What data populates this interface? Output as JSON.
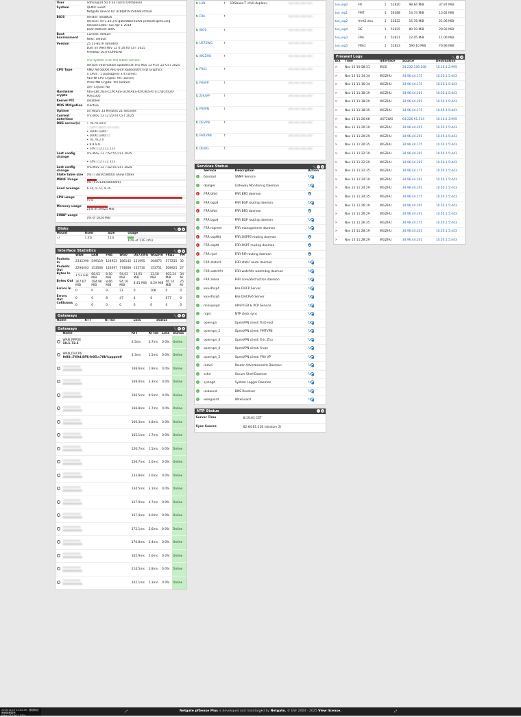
{
  "sysinfo": [
    {
      "k": "User",
      "v": [
        "admin@10.50.0.33 (Local Database)"
      ]
    },
    {
      "k": "System",
      "v": [
        "QEMU Guest",
        "Netgate Device ID: 4c6b8fc915d0843fc0ad"
      ]
    },
    {
      "k": "BIOS",
      "v": [
        "Vendor: SeaBIOS",
        "Version: rel-1.16.3-0-ga6ed6b701f0a-prebuilt.qemu.org",
        "Release Date: Tue Apr 1 2014",
        "Boot Method: BIOS"
      ]
    },
    {
      "k": "Boot Environment",
      "v": [
        "Current: default",
        "Next: default"
      ]
    },
    {
      "k": "Version",
      "v": [
        "25.11-BETA (amd64)",
        "built on Wed Nov 12 4:16:00 CST 2025",
        "FreeBSD 16.0-CURRENT",
        "",
        "The system is on the latest version.",
        "Version information updated at Thu Nov 13 9:57:22 CST 2025"
      ]
    },
    {
      "k": "CPU Type",
      "v": [
        "AMD A8-5600K APU with Radeon(tm) HD Graphics",
        "4 CPUs : 1 package(s) x 4 core(s)",
        "AES-NI CPU Crypto: Yes (active)",
        "IPsec-MB Crypto: Yes (active)",
        "QAT Crypto: No"
      ]
    },
    {
      "k": "Hardware crypto",
      "v": [
        "AES-CBC,AES-CCM,AES-GCM,AES-ICM,AES-XTS,ChaCha20-",
        "Poly1305"
      ]
    },
    {
      "k": "Kernel PTI",
      "v": [
        "Disabled"
      ]
    },
    {
      "k": "MDS Mitigation",
      "v": [
        "Inactive"
      ]
    },
    {
      "k": "Uptime",
      "v": [
        "04 Hours 33 Minutes 21 Seconds"
      ]
    },
    {
      "k": "Current date/time",
      "v": [
        "Thu Nov 13 12:20:47 CST 2025"
      ]
    },
    {
      "k": "DNS server(s)",
      "v": [
        "• 76.76.10.0",
        "• 2a07:a8c0::xx:xxxx",
        "• 2606:1a40::",
        "• 2606:1a40:1::",
        "• 76.76.2.0",
        "• 9.9.9.9",
        "• 149.112.112.112"
      ]
    },
    {
      "k": "Last config change",
      "v": [
        "Thu Nov 13 7:52:55 CST 2025",
        "",
        "• 149.112.112.112"
      ]
    },
    {
      "k": "Last config change",
      "v": [
        "Thu Nov 13 7:52:55 CST 2025"
      ]
    },
    {
      "k": "State table size",
      "v": [
        "0% (738/3058000) Show states"
      ]
    }
  ],
  "gauges": [
    {
      "k": "MBUF Usage",
      "v": "9% (470134/5000000)",
      "pct": 9,
      "top": true
    },
    {
      "k": "Load average",
      "v": "6.14, 5.72, 4.35",
      "pct": -1
    },
    {
      "k": "CPU usage",
      "v": "97%",
      "pct": 97
    },
    {
      "k": "Memory usage",
      "v": "21% of 20425 MiB",
      "pct": 21
    },
    {
      "k": "SWAP usage",
      "v": "0% of 1024 MiB",
      "pct": 0
    }
  ],
  "disks": {
    "title": "Disks",
    "headers": [
      "Mount",
      "Used",
      "Size",
      "Usage"
    ],
    "row": [
      "/",
      "1.2G",
      "11G",
      "10% of 11G (zfs)"
    ],
    "pct": 10
  },
  "ifstats": {
    "title": "Interface Statistics",
    "headers": [
      "",
      "WAN",
      "LAN",
      "FRA",
      "WG0",
      "US72WG",
      "WGZHU",
      "FRA1",
      "FM"
    ],
    "rows": [
      [
        "Packets In",
        "2332390",
        "549119",
        "124923",
        "186145",
        "151995",
        "164075",
        "577255",
        "32"
      ],
      [
        "Packets Out",
        "2294403",
        "353568",
        "128397",
        "774668",
        "155710",
        "153751",
        "568925",
        "27"
      ],
      [
        "Bytes In",
        "1.53 GiB",
        "68.63 MiB",
        "8.50 MiB",
        "94.62 MiB",
        "10.91 MiB",
        "11.58 MiB",
        "605.24 MiB",
        "34 Mi"
      ],
      [
        "Bytes Out",
        "367.67 MiB",
        "184.96 MiB",
        "8.66 MiB",
        "94.16 MiB",
        "8.41 MiB",
        "8.29 MiB",
        "46.14 MiB",
        "25 Mi"
      ],
      [
        "Errors In",
        "0",
        "0",
        "9",
        "21",
        "0",
        "108",
        "0",
        "0"
      ],
      [
        "Errors Out",
        "0",
        "0",
        "8",
        "47",
        "4",
        "6",
        "677",
        "0"
      ],
      [
        "Collisions",
        "0",
        "0",
        "0",
        "0",
        "0",
        "0",
        "0",
        "0"
      ]
    ]
  },
  "gateways_a": {
    "title": "Gateways",
    "headers": [
      "Name",
      "RTT",
      "RTTsd",
      "Loss",
      "Status"
    ]
  },
  "gateways_b": {
    "title": "Gateways",
    "headers": [
      "Name",
      "RTT",
      "RTTsd",
      "Loss",
      "Status"
    ],
    "rows": [
      [
        "WAN_PPPOE",
        "10.1.72.1",
        "2.5ms",
        "0.7ms",
        "0.0%",
        "Online",
        false
      ],
      [
        "WAN_DHCP6",
        "fe80::769d:8fff:fe05:c78b%pppoe0",
        "4.3ms",
        "2.5ms",
        "0.0%",
        "Online",
        false
      ],
      [
        "xxx",
        "xxx",
        "168.6ms",
        "1.9ms",
        "0.0%",
        "Online",
        true
      ],
      [
        "xxx",
        "xxx",
        "169.0ms",
        "3.3ms",
        "0.0%",
        "Online",
        true
      ],
      [
        "xxx",
        "xxx",
        "166.5ms",
        "9.5ms",
        "0.0%",
        "Online",
        true
      ],
      [
        "xxx",
        "xxx",
        "168.8ms",
        "2.7ms",
        "0.0%",
        "Online",
        true
      ],
      [
        "xxx",
        "xxx",
        "166.3ms",
        "0.8ms",
        "0.0%",
        "Online",
        true
      ],
      [
        "xxx",
        "xxx",
        "165.1ms",
        "1.7ms",
        "0.0%",
        "Online",
        true
      ],
      [
        "xxx",
        "xxx",
        "156.7ms",
        "1.5ms",
        "0.0%",
        "Online",
        true
      ],
      [
        "xxx",
        "xxx",
        "156.7ms",
        "2.0ms",
        "0.0%",
        "Online",
        true
      ],
      [
        "xxx",
        "xxx",
        "233.8ms",
        "2.6ms",
        "0.0%",
        "Online",
        true
      ],
      [
        "xxx",
        "xxx",
        "234.5ms",
        "3.1ms",
        "0.0%",
        "Online",
        true
      ],
      [
        "xxx",
        "xxx",
        "167.0ms",
        "4.7ms",
        "0.0%",
        "Online",
        true
      ],
      [
        "xxx",
        "xxx",
        "167.4ms",
        "6.0ms",
        "0.0%",
        "Online",
        true
      ],
      [
        "xxx",
        "xxx",
        "172.1ms",
        "5.6ms",
        "0.0%",
        "Online",
        true
      ],
      [
        "xxx",
        "xxx",
        "170.8ms",
        "3.4ms",
        "0.0%",
        "Online",
        true
      ],
      [
        "xxx",
        "xxx",
        "165.9ms",
        "5.6ms",
        "0.0%",
        "Online",
        true
      ],
      [
        "xxx",
        "xxx",
        "214.5ms",
        "1.8ms",
        "0.0%",
        "Online",
        true
      ],
      [
        "xxx",
        "xxx",
        "202.1ms",
        "2.3ms",
        "0.0%",
        "Online",
        true
      ]
    ]
  },
  "interfaces": [
    {
      "n": "LAN",
      "v": "10Gbase-T <full-duplex>"
    },
    {
      "n": "FRA",
      "v": ""
    },
    {
      "n": "WG0",
      "v": ""
    },
    {
      "n": "US72WG",
      "v": ""
    },
    {
      "n": "WGZHU",
      "v": ""
    },
    {
      "n": "FRA1",
      "v": ""
    },
    {
      "n": "FRAVP",
      "v": ""
    },
    {
      "n": "ZHUVP",
      "v": ""
    },
    {
      "n": "FRVPN",
      "v": ""
    },
    {
      "n": "DEVPN",
      "v": ""
    },
    {
      "n": "FMTVPN",
      "v": ""
    },
    {
      "n": "DEWG",
      "v": ""
    }
  ],
  "services": {
    "title": "Services Status",
    "headers": [
      "",
      "Service",
      "Description",
      "Action"
    ],
    "rows": [
      [
        "ok",
        "bsnmpd",
        "SNMP Service",
        "r"
      ],
      [
        "ok",
        "dpinger",
        "Gateway Monitoring Daemon",
        "r"
      ],
      [
        "bad",
        "FRR bfdd",
        "FRR BFD daemon",
        "g"
      ],
      [
        "ok",
        "FRR bgpd",
        "FRR BGP routing daemon",
        "r"
      ],
      [
        "bad",
        "FRR bfdd",
        "FRR BFD daemon",
        "g"
      ],
      [
        "ok",
        "FRR bgpd",
        "FRR BGP routing daemon",
        "r"
      ],
      [
        "ok",
        "FRR mgmtd",
        "FRR management daemon",
        "r"
      ],
      [
        "bad",
        "FRR ospf6d",
        "FRR OSPF6 routing daemon",
        "g"
      ],
      [
        "bad",
        "FRR ospfd",
        "FRR OSPF routing daemon",
        "g"
      ],
      [
        "bad",
        "FRR ripd",
        "FRR RIP routing daemon",
        "g"
      ],
      [
        "ok",
        "FRR staticd",
        "FRR static route daemon",
        "r"
      ],
      [
        "ok",
        "FRR watchfrr",
        "FRR watchfrr watchdog daemon",
        "r"
      ],
      [
        "ok",
        "FRR zebra",
        "FRR core/abstraction daemon",
        "r"
      ],
      [
        "ok",
        "kea-dhcp4",
        "Kea DHCP Server",
        "r"
      ],
      [
        "ok",
        "kea-dhcp6",
        "Kea DHCPv6 Server",
        "r"
      ],
      [
        "ok",
        "miniupnpd",
        "UPnP IGD & PCP Service",
        "r"
      ],
      [
        "ok",
        "ntpd",
        "NTP clock sync",
        "r"
      ],
      [
        "ok",
        "openvpn",
        "OpenVPN client: first-root",
        "r"
      ],
      [
        "ok",
        "openvpn_2",
        "OpenVPN client: FMTVPN",
        "r"
      ],
      [
        "ok",
        "openvpn_3",
        "OpenVPN client: Eric Zhu",
        "r"
      ],
      [
        "ok",
        "openvpn_4",
        "OpenVPN client: frvpn",
        "r"
      ],
      [
        "ok",
        "openvpn_5",
        "OpenVPN client: FRA VP",
        "r"
      ],
      [
        "ok",
        "radvd",
        "Router Advertisement Daemon",
        "r"
      ],
      [
        "ok",
        "sshd",
        "Secure Shell Daemon",
        "r"
      ],
      [
        "ok",
        "syslogd",
        "System Logger Daemon",
        "r"
      ],
      [
        "ok",
        "unbound",
        "DNS Resolver",
        "r"
      ],
      [
        "ok",
        "wireguard",
        "WireGuard",
        "r"
      ]
    ]
  },
  "ntp": {
    "title": "NTP Status",
    "rows": [
      [
        "Server Time",
        "8:19:03 CST"
      ],
      [
        "Sync Source",
        "82.64.81.218 (stratum 2)"
      ]
    ]
  },
  "tunnels": [
    [
      "tun_wg0",
      "FR",
      "1",
      "51820",
      "98.84 MiB",
      "37.87 MiB"
    ],
    [
      "tun_wg1",
      "FMT",
      "1",
      "56388",
      "14.74 MiB",
      "13.62 MiB"
    ],
    [
      "tun_wg2",
      "frmt2 zhu",
      "1",
      "51822",
      "15.78 MiB",
      "21.06 MiB"
    ],
    [
      "tun_wg4",
      "DE",
      "1",
      "52825",
      "80.19 MiB",
      "20.92 MiB"
    ],
    [
      "tun_wg3",
      "FRA",
      "1",
      "51821",
      "12.05 MiB",
      "11.06 MiB"
    ],
    [
      "tun_wg5",
      "FRA1",
      "1",
      "51823",
      "590.10 MiB",
      "70.96 MiB"
    ]
  ],
  "firewall": {
    "title": "Firewall Logs",
    "headers": [
      "Act",
      "Time",
      "Interface",
      "Source",
      "Destination"
    ],
    "rows": [
      [
        "Nov 13 10:58:31",
        "WG0",
        "34.232.109.108",
        "10.16.1.2:995"
      ],
      [
        "Nov 13 11:14:34",
        "WGZHU",
        "34.96.44.175",
        "10.50.1.5:443"
      ],
      [
        "Nov 13 11:16:34",
        "WGZHU",
        "34.96.44.175",
        "10.50.1.5:443"
      ],
      [
        "Nov 13 11:18:19",
        "WGZHU",
        "34.96.44.201",
        "10.50.1.5:443"
      ],
      [
        "Nov 13 11:18:29",
        "WGZHU",
        "34.96.44.201",
        "10.50.1.5:443"
      ],
      [
        "Nov 13 11:18:35",
        "WGZHU",
        "34.96.44.175",
        "10.50.1.5:443"
      ],
      [
        "Nov 13 11:20:06",
        "US72WG",
        "64.226.91.114",
        "10.10.2.3:995"
      ],
      [
        "Nov 13 11:20:19",
        "WGZHU",
        "34.96.44.201",
        "10.50.1.5:443"
      ],
      [
        "Nov 13 11:20:29",
        "WGZHU",
        "34.96.44.201",
        "10.50.1.5:443"
      ],
      [
        "Nov 13 11:20:35",
        "WGZHU",
        "34.96.44.175",
        "10.50.1.5:443"
      ],
      [
        "Nov 13 11:22:19",
        "WGZHU",
        "34.96.44.201",
        "10.50.1.5:443"
      ],
      [
        "Nov 13 11:22:29",
        "WGZHU",
        "34.96.44.201",
        "10.50.1.5:443"
      ],
      [
        "Nov 13 11:22:35",
        "WGZHU",
        "34.96.44.175",
        "10.50.1.5:443"
      ],
      [
        "Nov 13 11:24:19",
        "WGZHU",
        "34.96.44.201",
        "10.50.1.5:443"
      ],
      [
        "Nov 13 11:24:29",
        "WGZHU",
        "34.96.44.201",
        "10.50.1.5:443"
      ],
      [
        "Nov 13 11:24:35",
        "WGZHU",
        "34.96.44.175",
        "10.50.1.5:443"
      ],
      [
        "Nov 13 11:26:19",
        "WGZHU",
        "34.96.44.201",
        "10.50.1.5:443"
      ],
      [
        "Nov 13 11:26:29",
        "WGZHU",
        "34.96.44.201",
        "10.50.1.5:443"
      ],
      [
        "Nov 13 11:26:35",
        "WGZHU",
        "34.96.44.175",
        "10.50.1.5:443"
      ],
      [
        "Nov 13 11:28:19",
        "WGZHU",
        "34.96.44.201",
        "10.50.1.5:443"
      ],
      [
        "Nov 13 11:28:29",
        "WGZHU",
        "34.96.44.201",
        "10.50.1.5:443"
      ]
    ]
  },
  "footer": {
    "pre": "Netgate pfSense Plus",
    "mid": "is developed and maintained by",
    "brand": "Netgate.",
    "post": "© ESF 2004 - 2025",
    "license": "View license."
  },
  "taskbar": {
    "line1": "2025/11/13 12:20:49 - 基地网页面面板刷新秒",
    "line2": "https://10.50.1.250/"
  },
  "colors": {
    "header": "#424242",
    "online": "#c7efc7",
    "bar_red": "#c02d2d",
    "link": "#1e64b4"
  }
}
